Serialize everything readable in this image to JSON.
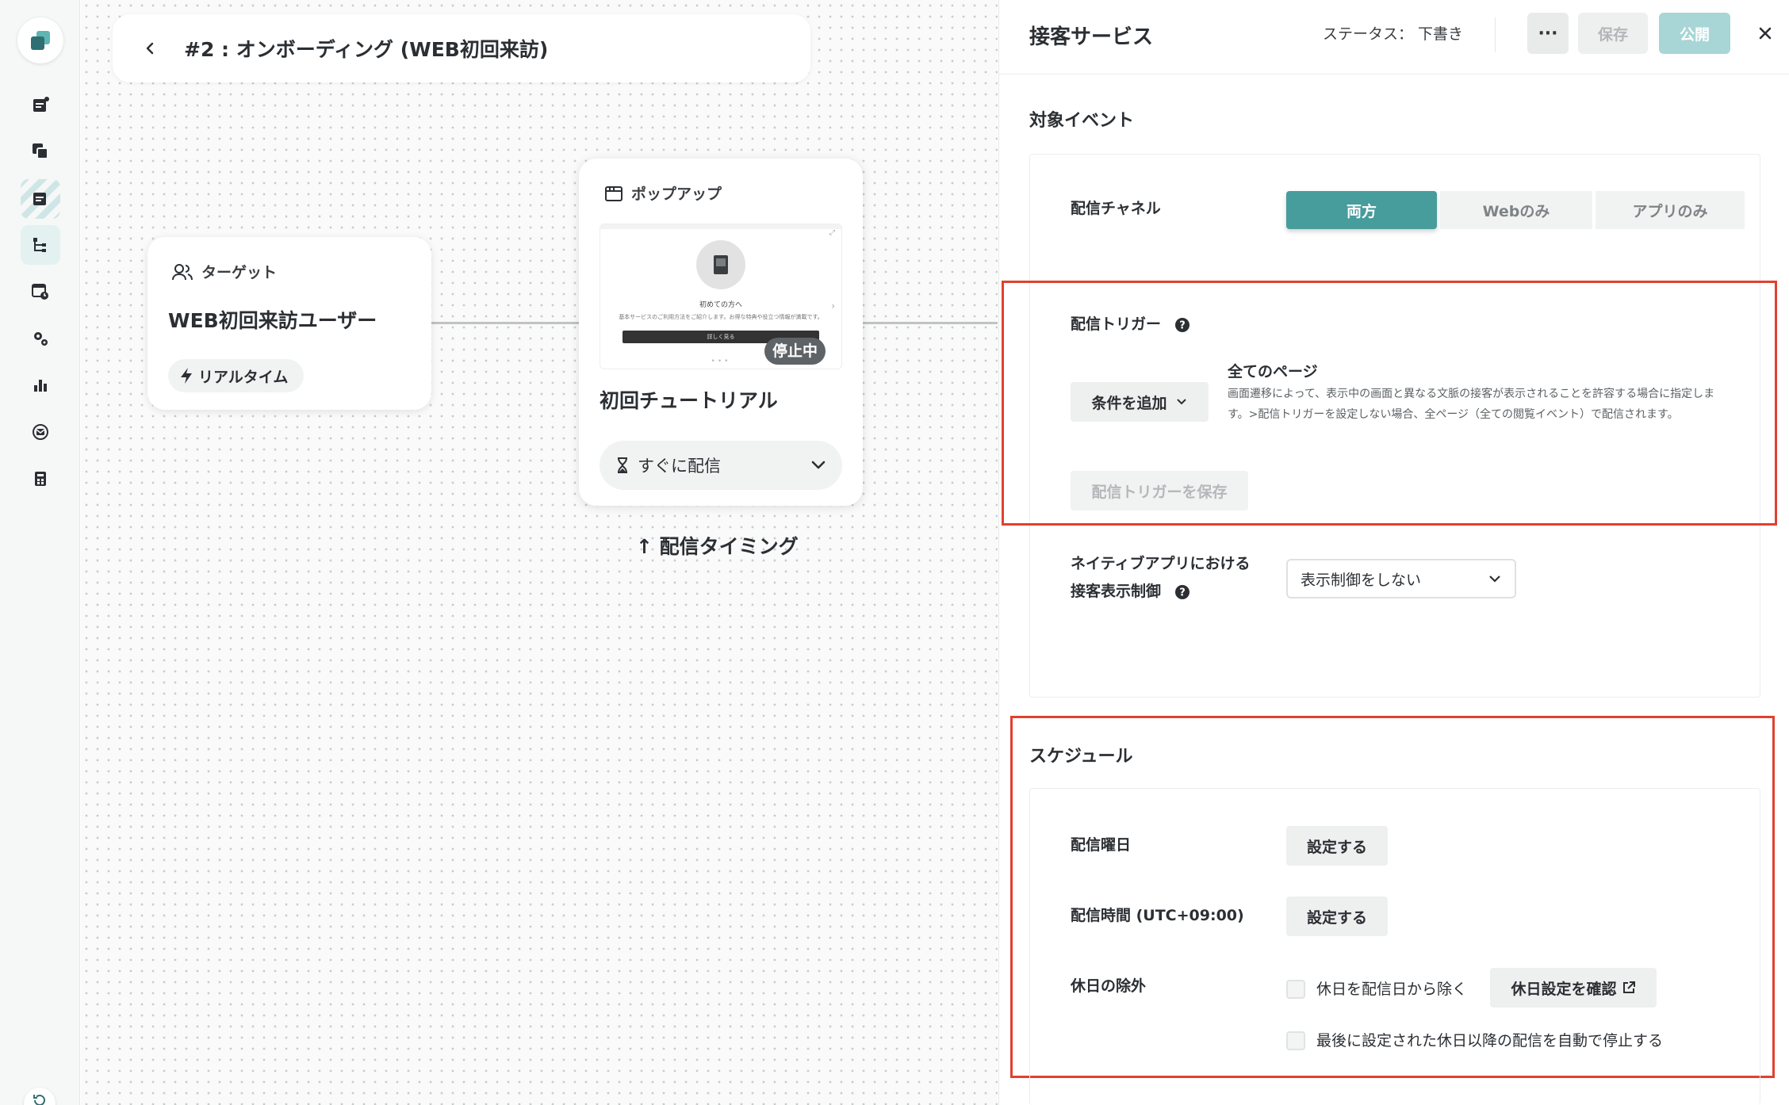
{
  "flow": {
    "title": "#2 : オンボーディング (WEB初回来訪)"
  },
  "target_node": {
    "header": "ターゲット",
    "title": "WEB初回来訪ユーザー",
    "badge": "リアルタイム"
  },
  "popup_node": {
    "header": "ポップアップ",
    "preview_heading": "初めての方へ",
    "preview_body": "基本サービスのご利用方法をご紹介します。お得な特典や役立つ情報が満載です。",
    "preview_button": "詳しく見る",
    "status_badge": "停止中",
    "title": "初回チュートリアル",
    "timing": "すぐに配信"
  },
  "timing_note": "↑ 配信タイミング",
  "panel": {
    "title": "接客サービス",
    "status": "ステータス：  下書き",
    "more_label": "···",
    "save_label": "保存",
    "publish_label": "公開",
    "target_event": {
      "title": "対象イベント",
      "channel_label": "配信チャネル",
      "channels": [
        "両方",
        "Webのみ",
        "アプリのみ"
      ],
      "selected_channel": "両方",
      "trigger_label": "配信トリガー",
      "add_condition": "条件を追加",
      "trigger_title": "全てのページ",
      "trigger_desc": "画面遷移によって、表示中の画面と異なる文脈の接客が表示されることを許容する場合に指定します。>配信トリガーを設定しない場合、全ページ（全ての閲覧イベント）で配信されます。",
      "save_trigger": "配信トリガーを保存",
      "native_label_1": "ネイティブアプリにおける",
      "native_label_2": "接客表示制御",
      "native_value": "表示制御をしない"
    },
    "schedule": {
      "title": "スケジュール",
      "weekday_label": "配信曜日",
      "weekday_button": "設定する",
      "time_label": "配信時間 (UTC+09:00)",
      "time_button": "設定する",
      "holiday_label": "休日の除外",
      "holiday_check1": "休日を配信日から除く",
      "holiday_settings": "休日設定を確認",
      "holiday_check2": "最後に設定された休日以降の配信を自動で停止する"
    }
  },
  "colors": {
    "accent": "#479c9c",
    "accent_light": "#a8d6d6",
    "highlight": "#e0412f"
  }
}
